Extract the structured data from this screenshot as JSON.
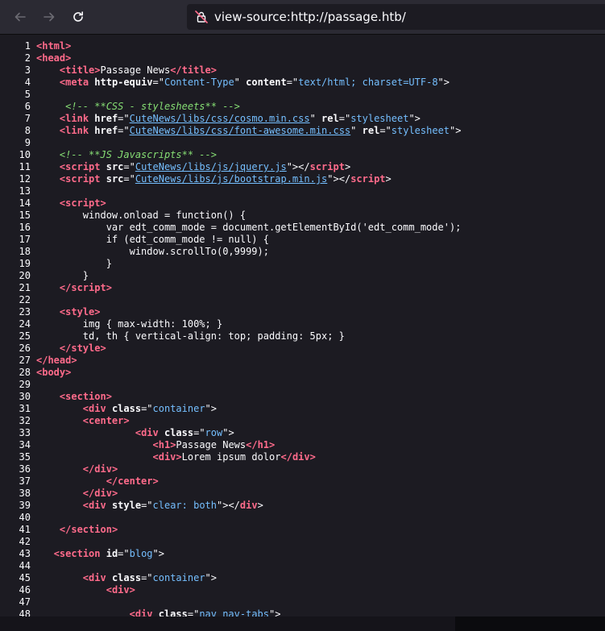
{
  "browser": {
    "url": "view-source:http://passage.htb/",
    "icons": {
      "back": "arrow-left-icon",
      "forward": "arrow-right-icon",
      "reload": "reload-icon",
      "site": "connection-not-secure-icon"
    }
  },
  "source_lines": [
    {
      "n": "1",
      "t": [
        [
          "tag",
          "<"
        ],
        [
          "tag",
          "html"
        ],
        [
          "tag",
          ">"
        ]
      ]
    },
    {
      "n": "2",
      "t": [
        [
          "tag",
          "<"
        ],
        [
          "tag",
          "head"
        ],
        [
          "tag",
          ">"
        ]
      ]
    },
    {
      "n": "3",
      "t": [
        [
          "plain",
          "    "
        ],
        [
          "tag",
          "<"
        ],
        [
          "tag",
          "title"
        ],
        [
          "tag",
          ">"
        ],
        [
          "plain",
          "Passage News"
        ],
        [
          "tag",
          "</"
        ],
        [
          "tag",
          "title"
        ],
        [
          "tag",
          ">"
        ]
      ]
    },
    {
      "n": "4",
      "t": [
        [
          "plain",
          "    "
        ],
        [
          "tag",
          "<"
        ],
        [
          "tag",
          "meta "
        ],
        [
          "attr",
          "http-equiv"
        ],
        [
          "plain",
          "=\""
        ],
        [
          "val",
          "Content-Type"
        ],
        [
          "plain",
          "\" "
        ],
        [
          "attr",
          "content"
        ],
        [
          "plain",
          "=\""
        ],
        [
          "val",
          "text/html; charset=UTF-8"
        ],
        [
          "plain",
          "\">"
        ]
      ]
    },
    {
      "n": "5",
      "t": []
    },
    {
      "n": "6",
      "t": [
        [
          "plain",
          "     "
        ],
        [
          "comment",
          "<!-- **CSS - stylesheets** -->"
        ]
      ]
    },
    {
      "n": "7",
      "t": [
        [
          "plain",
          "    "
        ],
        [
          "tag",
          "<"
        ],
        [
          "tag",
          "link "
        ],
        [
          "attr",
          "href"
        ],
        [
          "plain",
          "=\""
        ],
        [
          "link",
          "CuteNews/libs/css/cosmo.min.css"
        ],
        [
          "plain",
          "\" "
        ],
        [
          "attr",
          "rel"
        ],
        [
          "plain",
          "=\""
        ],
        [
          "val",
          "stylesheet"
        ],
        [
          "plain",
          "\">"
        ]
      ]
    },
    {
      "n": "8",
      "t": [
        [
          "plain",
          "    "
        ],
        [
          "tag",
          "<"
        ],
        [
          "tag",
          "link "
        ],
        [
          "attr",
          "href"
        ],
        [
          "plain",
          "=\""
        ],
        [
          "link",
          "CuteNews/libs/css/font-awesome.min.css"
        ],
        [
          "plain",
          "\" "
        ],
        [
          "attr",
          "rel"
        ],
        [
          "plain",
          "=\""
        ],
        [
          "val",
          "stylesheet"
        ],
        [
          "plain",
          "\">"
        ]
      ]
    },
    {
      "n": "9",
      "t": []
    },
    {
      "n": "10",
      "t": [
        [
          "plain",
          "    "
        ],
        [
          "comment",
          "<!-- **JS Javascripts** -->"
        ]
      ]
    },
    {
      "n": "11",
      "t": [
        [
          "plain",
          "    "
        ],
        [
          "tag",
          "<"
        ],
        [
          "tag",
          "script "
        ],
        [
          "attr",
          "src"
        ],
        [
          "plain",
          "=\""
        ],
        [
          "link",
          "CuteNews/libs/js/jquery.js"
        ],
        [
          "plain",
          "\"></"
        ],
        [
          "tag",
          "script"
        ],
        [
          "plain",
          ">"
        ]
      ]
    },
    {
      "n": "12",
      "t": [
        [
          "plain",
          "    "
        ],
        [
          "tag",
          "<"
        ],
        [
          "tag",
          "script "
        ],
        [
          "attr",
          "src"
        ],
        [
          "plain",
          "=\""
        ],
        [
          "link",
          "CuteNews/libs/js/bootstrap.min.js"
        ],
        [
          "plain",
          "\"></"
        ],
        [
          "tag",
          "script"
        ],
        [
          "plain",
          ">"
        ]
      ]
    },
    {
      "n": "13",
      "t": []
    },
    {
      "n": "14",
      "t": [
        [
          "plain",
          "    "
        ],
        [
          "tag",
          "<"
        ],
        [
          "tag",
          "script"
        ],
        [
          "tag",
          ">"
        ]
      ]
    },
    {
      "n": "15",
      "t": [
        [
          "plain",
          "        window.onload = function() {"
        ]
      ]
    },
    {
      "n": "16",
      "t": [
        [
          "plain",
          "            var edt_comm_mode = document.getElementById('edt_comm_mode');"
        ]
      ]
    },
    {
      "n": "17",
      "t": [
        [
          "plain",
          "            if (edt_comm_mode != null) {"
        ]
      ]
    },
    {
      "n": "18",
      "t": [
        [
          "plain",
          "                window.scrollTo(0,9999);"
        ]
      ]
    },
    {
      "n": "19",
      "t": [
        [
          "plain",
          "            }"
        ]
      ]
    },
    {
      "n": "20",
      "t": [
        [
          "plain",
          "        }"
        ]
      ]
    },
    {
      "n": "21",
      "t": [
        [
          "plain",
          "    "
        ],
        [
          "tag",
          "</"
        ],
        [
          "tag",
          "script"
        ],
        [
          "tag",
          ">"
        ]
      ]
    },
    {
      "n": "22",
      "t": []
    },
    {
      "n": "23",
      "t": [
        [
          "plain",
          "    "
        ],
        [
          "tag",
          "<"
        ],
        [
          "tag",
          "style"
        ],
        [
          "tag",
          ">"
        ]
      ]
    },
    {
      "n": "24",
      "t": [
        [
          "plain",
          "        img { max-width: 100%; }"
        ]
      ]
    },
    {
      "n": "25",
      "t": [
        [
          "plain",
          "        td, th { vertical-align: top; padding: 5px; }"
        ]
      ]
    },
    {
      "n": "26",
      "t": [
        [
          "plain",
          "    "
        ],
        [
          "tag",
          "</"
        ],
        [
          "tag",
          "style"
        ],
        [
          "tag",
          ">"
        ]
      ]
    },
    {
      "n": "27",
      "t": [
        [
          "tag",
          "</"
        ],
        [
          "tag",
          "head"
        ],
        [
          "tag",
          ">"
        ]
      ]
    },
    {
      "n": "28",
      "t": [
        [
          "tag",
          "<"
        ],
        [
          "tag",
          "body"
        ],
        [
          "tag",
          ">"
        ]
      ]
    },
    {
      "n": "29",
      "t": []
    },
    {
      "n": "30",
      "t": [
        [
          "plain",
          "    "
        ],
        [
          "tag",
          "<"
        ],
        [
          "tag",
          "section"
        ],
        [
          "tag",
          ">"
        ]
      ]
    },
    {
      "n": "31",
      "t": [
        [
          "plain",
          "        "
        ],
        [
          "tag",
          "<"
        ],
        [
          "tag",
          "div "
        ],
        [
          "attr",
          "class"
        ],
        [
          "plain",
          "=\""
        ],
        [
          "val",
          "container"
        ],
        [
          "plain",
          "\">"
        ]
      ]
    },
    {
      "n": "32",
      "t": [
        [
          "plain",
          "        "
        ],
        [
          "tag",
          "<"
        ],
        [
          "tag",
          "center"
        ],
        [
          "tag",
          ">"
        ]
      ]
    },
    {
      "n": "33",
      "t": [
        [
          "plain",
          "                 "
        ],
        [
          "tag",
          "<"
        ],
        [
          "tag",
          "div "
        ],
        [
          "attr",
          "class"
        ],
        [
          "plain",
          "=\""
        ],
        [
          "val",
          "row"
        ],
        [
          "plain",
          "\">"
        ]
      ]
    },
    {
      "n": "34",
      "t": [
        [
          "plain",
          "                    "
        ],
        [
          "tag",
          "<"
        ],
        [
          "tag",
          "h1"
        ],
        [
          "tag",
          ">"
        ],
        [
          "plain",
          "Passage News"
        ],
        [
          "tag",
          "</"
        ],
        [
          "tag",
          "h1"
        ],
        [
          "tag",
          ">"
        ]
      ]
    },
    {
      "n": "35",
      "t": [
        [
          "plain",
          "                    "
        ],
        [
          "tag",
          "<"
        ],
        [
          "tag",
          "div"
        ],
        [
          "tag",
          ">"
        ],
        [
          "plain",
          "Lorem ipsum dolor"
        ],
        [
          "tag",
          "</"
        ],
        [
          "tag",
          "div"
        ],
        [
          "tag",
          ">"
        ]
      ]
    },
    {
      "n": "36",
      "t": [
        [
          "plain",
          "        "
        ],
        [
          "tag",
          "</"
        ],
        [
          "tag",
          "div"
        ],
        [
          "tag",
          ">"
        ]
      ]
    },
    {
      "n": "37",
      "t": [
        [
          "plain",
          "            "
        ],
        [
          "tag",
          "</"
        ],
        [
          "tag",
          "center"
        ],
        [
          "tag",
          ">"
        ]
      ]
    },
    {
      "n": "38",
      "t": [
        [
          "plain",
          "        "
        ],
        [
          "tag",
          "</"
        ],
        [
          "tag",
          "div"
        ],
        [
          "tag",
          ">"
        ]
      ]
    },
    {
      "n": "39",
      "t": [
        [
          "plain",
          "        "
        ],
        [
          "tag",
          "<"
        ],
        [
          "tag",
          "div "
        ],
        [
          "attr",
          "style"
        ],
        [
          "plain",
          "=\""
        ],
        [
          "val",
          "clear: both"
        ],
        [
          "plain",
          "\"></"
        ],
        [
          "tag",
          "div"
        ],
        [
          "plain",
          ">"
        ]
      ]
    },
    {
      "n": "40",
      "t": []
    },
    {
      "n": "41",
      "t": [
        [
          "plain",
          "    "
        ],
        [
          "tag",
          "</"
        ],
        [
          "tag",
          "section"
        ],
        [
          "tag",
          ">"
        ]
      ]
    },
    {
      "n": "42",
      "t": []
    },
    {
      "n": "43",
      "t": [
        [
          "plain",
          "   "
        ],
        [
          "tag",
          "<"
        ],
        [
          "tag",
          "section "
        ],
        [
          "attr",
          "id"
        ],
        [
          "plain",
          "=\""
        ],
        [
          "val",
          "blog"
        ],
        [
          "plain",
          "\">"
        ]
      ]
    },
    {
      "n": "44",
      "t": []
    },
    {
      "n": "45",
      "t": [
        [
          "plain",
          "        "
        ],
        [
          "tag",
          "<"
        ],
        [
          "tag",
          "div "
        ],
        [
          "attr",
          "class"
        ],
        [
          "plain",
          "=\""
        ],
        [
          "val",
          "container"
        ],
        [
          "plain",
          "\">"
        ]
      ]
    },
    {
      "n": "46",
      "t": [
        [
          "plain",
          "            "
        ],
        [
          "tag",
          "<"
        ],
        [
          "tag",
          "div"
        ],
        [
          "tag",
          ">"
        ]
      ]
    },
    {
      "n": "47",
      "t": []
    },
    {
      "n": "48",
      "t": [
        [
          "plain",
          "                "
        ],
        [
          "tag",
          "<"
        ],
        [
          "tag",
          "div "
        ],
        [
          "attr",
          "class"
        ],
        [
          "plain",
          "=\""
        ],
        [
          "val",
          "nav nav-tabs"
        ],
        [
          "plain",
          "\">"
        ]
      ]
    }
  ],
  "colors": {
    "tag": "#ff6b8b",
    "attr": "#fbfbfe",
    "value": "#75bfff",
    "comment": "#86de74",
    "text": "#fbfbfe",
    "background": "#1c1b22",
    "toolbar": "#2b2a33"
  }
}
